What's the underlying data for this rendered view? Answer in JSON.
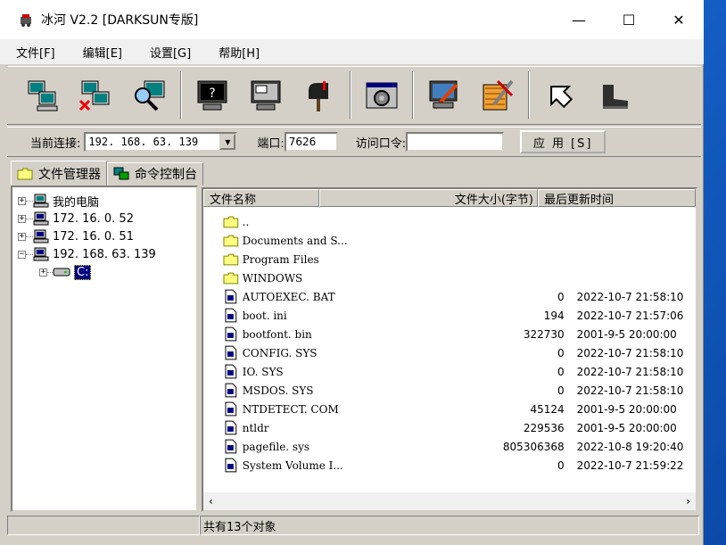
{
  "window": {
    "title": "冰河 V2.2 [DARKSUN专版]",
    "controls": {
      "minimize": "—",
      "maximize": "☐",
      "close": "✕"
    }
  },
  "menu": [
    "文件[F]",
    "编辑[E]",
    "设置[G]",
    "帮助[H]"
  ],
  "toolbar": {
    "buttons": [
      "add-host-icon",
      "delete-host-icon",
      "search-host-icon",
      "help-monitor-icon",
      "screen-monitor-icon",
      "mailbox-icon",
      "settings-icon",
      "edit-icon",
      "tools-icon",
      "back-icon",
      "boot-icon"
    ]
  },
  "connection": {
    "current_label": "当前连接:",
    "current_value": "192. 168. 63. 139",
    "port_label": "端口:",
    "port_value": "7626",
    "password_label": "访问口令:",
    "password_value": "",
    "apply_label": "应 用 [S]"
  },
  "tabs": [
    "文件管理器",
    "命令控制台"
  ],
  "tree": {
    "root": "我的电脑",
    "hosts": [
      "172. 16. 0. 52",
      "172. 16. 0. 51",
      "192. 168. 63. 139"
    ],
    "drive": "C:"
  },
  "list": {
    "headers": [
      "文件名称",
      "文件大小(字节)",
      "最后更新时间"
    ],
    "rows": [
      {
        "name": "..",
        "type": "folder",
        "size": "",
        "time": ""
      },
      {
        "name": "Documents and S...",
        "type": "folder",
        "size": "",
        "time": ""
      },
      {
        "name": "Program Files",
        "type": "folder",
        "size": "",
        "time": ""
      },
      {
        "name": "WINDOWS",
        "type": "folder",
        "size": "",
        "time": ""
      },
      {
        "name": "AUTOEXEC. BAT",
        "type": "file",
        "size": "0",
        "time": "2022-10-7 21:58:10"
      },
      {
        "name": "boot. ini",
        "type": "file",
        "size": "194",
        "time": "2022-10-7 21:57:06"
      },
      {
        "name": "bootfont. bin",
        "type": "file",
        "size": "322730",
        "time": "2001-9-5 20:00:00"
      },
      {
        "name": "CONFIG. SYS",
        "type": "file",
        "size": "0",
        "time": "2022-10-7 21:58:10"
      },
      {
        "name": "IO. SYS",
        "type": "file",
        "size": "0",
        "time": "2022-10-7 21:58:10"
      },
      {
        "name": "MSDOS. SYS",
        "type": "file",
        "size": "0",
        "time": "2022-10-7 21:58:10"
      },
      {
        "name": "NTDETECT. COM",
        "type": "file",
        "size": "45124",
        "time": "2001-9-5 20:00:00"
      },
      {
        "name": "ntldr",
        "type": "file",
        "size": "229536",
        "time": "2001-9-5 20:00:00"
      },
      {
        "name": "pagefile. sys",
        "type": "file",
        "size": "805306368",
        "time": "2022-10-8 19:20:40"
      },
      {
        "name": "System Volume I...",
        "type": "file",
        "size": "0",
        "time": "2022-10-7 21:59:22"
      }
    ]
  },
  "status": {
    "left": "",
    "right": "共有13个对象"
  },
  "scroll": {
    "left": "‹",
    "right": "›"
  }
}
